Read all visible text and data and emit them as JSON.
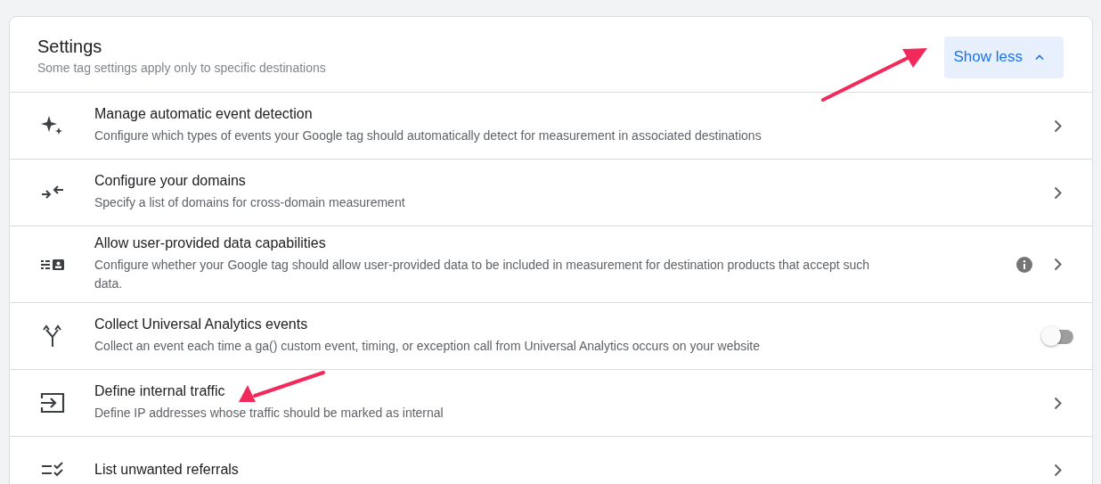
{
  "header": {
    "title": "Settings",
    "subtitle": "Some tag settings apply only to specific destinations",
    "toggle_button": {
      "label": "Show less",
      "expanded": true,
      "pointed_at": true
    }
  },
  "items": [
    {
      "title": "Manage automatic event detection",
      "description": "Configure which types of events your Google tag should automatically detect for measurement in associated destinations",
      "kind": "link",
      "info": false,
      "pointed_at": false
    },
    {
      "title": "Configure your domains",
      "description": "Specify a list of domains for cross-domain measurement",
      "kind": "link",
      "info": false,
      "pointed_at": false
    },
    {
      "title": "Allow user-provided data capabilities",
      "description": "Configure whether your Google tag should allow user-provided data to be included in measurement for destination products that accept such data.",
      "kind": "link",
      "info": true,
      "pointed_at": false
    },
    {
      "title": "Collect Universal Analytics events",
      "description": "Collect an event each time a ga() custom event, timing, or exception call from Universal Analytics occurs on your website",
      "kind": "toggle",
      "on": false,
      "info": false,
      "pointed_at": false
    },
    {
      "title": "Define internal traffic",
      "description": "Define IP addresses whose traffic should be marked as internal",
      "kind": "link",
      "info": false,
      "pointed_at": true
    },
    {
      "title": "List unwanted referrals",
      "kind": "link",
      "info": false,
      "pointed_at": false
    }
  ]
}
